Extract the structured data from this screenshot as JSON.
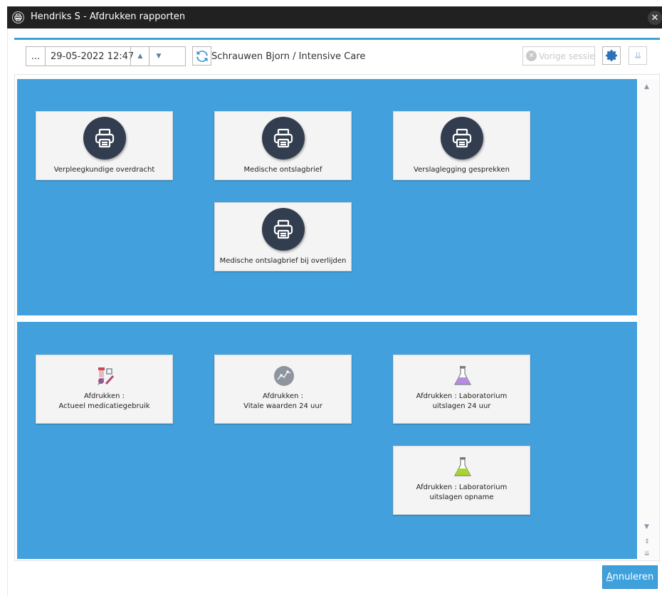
{
  "window": {
    "title": "Hendriks S - Afdrukken rapporten",
    "close_label": "✕"
  },
  "toolbar": {
    "dots_label": "...",
    "datetime": "29-05-2022 12:47",
    "up_label": "▲",
    "down_label": "▼",
    "patient": "Schrauwen Bjorn / Intensive Care",
    "previous_session": "Vorige sessie",
    "collapse_label": "⇊"
  },
  "sections": [
    {
      "tiles": [
        {
          "label": "Verpleegkundige overdracht",
          "icon": "printer-icon"
        },
        {
          "label": "Medische ontslagbrief",
          "icon": "printer-icon"
        },
        {
          "label": "Verslaglegging gesprekken",
          "icon": "printer-icon"
        },
        {
          "label": "Medische ontslagbrief bij overlijden",
          "icon": "printer-icon"
        }
      ]
    },
    {
      "tiles": [
        {
          "label": "Afdrukken :\nActueel medicatiegebruik",
          "icon": "medication-icon"
        },
        {
          "label": "Afdrukken :\nVitale waarden 24 uur",
          "icon": "vitals-chart-icon"
        },
        {
          "label": "Afdrukken : Laboratorium\nuitslagen 24 uur",
          "icon": "flask-purple-icon"
        },
        {
          "label": "Afdrukken : Laboratorium\nuitslagen opname",
          "icon": "flask-green-icon"
        }
      ]
    }
  ],
  "footer": {
    "cancel_first": "A",
    "cancel_rest": "nnuleren"
  },
  "colors": {
    "section_bg": "#42a1dd",
    "accent": "#3ea1dc",
    "titlebar": "#212121",
    "print_circle": "#323e50"
  }
}
